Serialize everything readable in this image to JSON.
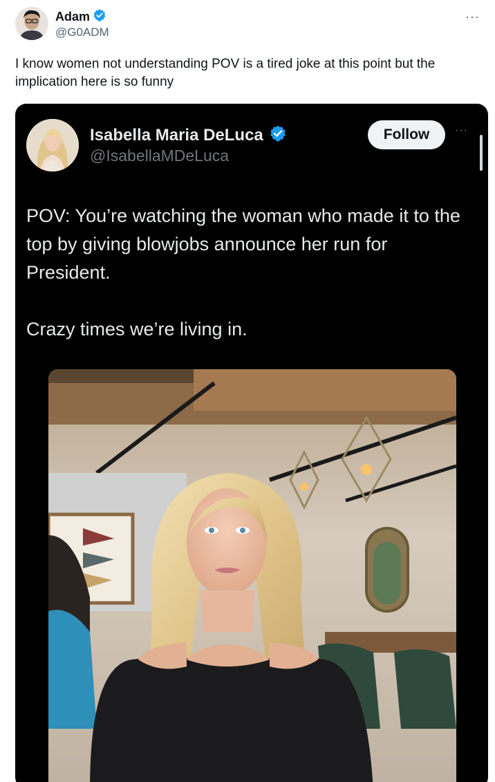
{
  "tweet": {
    "author": {
      "name": "Adam",
      "handle": "@G0ADM",
      "verified": true,
      "avatar_icon": "profile-photo"
    },
    "more_icon": "more-horizontal-icon",
    "text": "I know women not understanding POV is a tired joke at this point but the implication here is so funny"
  },
  "quoted_post": {
    "author": {
      "name": "Isabella Maria DeLuca",
      "handle": "@IsabellaMDeLuca",
      "verified": true,
      "avatar_icon": "profile-photo"
    },
    "follow_label": "Follow",
    "more_icon": "more-horizontal-icon",
    "text_line1": "POV: You’re watching the woman who made it to the top by giving blowjobs announce her run for President.",
    "text_line2": "Crazy times we’re living in.",
    "media_icon": "photo-of-woman-in-restaurant"
  },
  "colors": {
    "verified_blue": "#1d9bf0",
    "embed_background": "#000000",
    "follow_button_bg": "#eff3f4"
  }
}
